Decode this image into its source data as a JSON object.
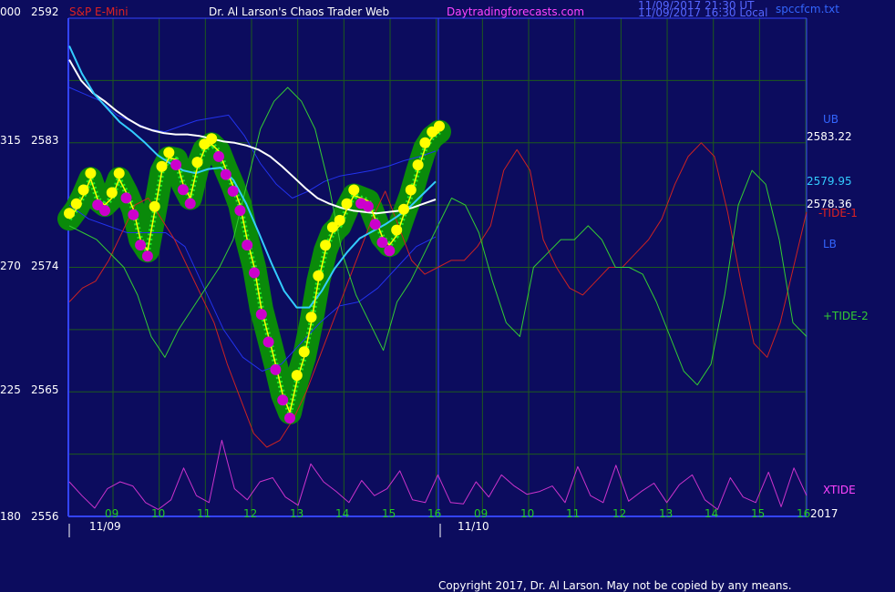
{
  "header": {
    "left_code": "000",
    "instrument": "S&P E-Mini",
    "app_title": "Dr. Al Larson's Chaos Trader Web",
    "site": "Daytradingforecasts.com",
    "time_utc": "11/09/2017 21:30 UT",
    "time_local": "11/09/2017 16:30 Local",
    "file": "spccfcm.txt"
  },
  "footer": {
    "copyright": "Copyright 2017, Dr. Al Larson. May not be copied by any means."
  },
  "colors": {
    "background": "#0c0c5e",
    "grid": "#1d5a1d",
    "frame": "#3344ff",
    "price_band": "#0a8a0a",
    "up_dot": "#ffff00",
    "down_dot": "#cc00cc",
    "white_ma": "#ffffff",
    "cyan_ma": "#33ccff",
    "band": "#2233ee",
    "tide1": "#cc2222",
    "tide2": "#33cc33",
    "xtide": "#cc33cc"
  },
  "chart_data": {
    "type": "line",
    "title": "S&P E-Mini",
    "ylim": [
      2556,
      2592
    ],
    "y_ticks": [
      {
        "code": "000",
        "value": "2592"
      },
      {
        "code": "315",
        "value": "2583"
      },
      {
        "code": "270",
        "value": "2574"
      },
      {
        "code": "225",
        "value": "2565"
      },
      {
        "code": "180",
        "value": "2556"
      }
    ],
    "x_hour_labels": [
      "09",
      "10",
      "11",
      "12",
      "13",
      "14",
      "15",
      "16",
      "09",
      "10",
      "11",
      "12",
      "13",
      "14",
      "15",
      "16"
    ],
    "x_date_labels": [
      "11/09",
      "11/10"
    ],
    "year_label": "2017",
    "right_labels": {
      "ub": "UB",
      "value1": "2583.22",
      "value2": "2579.95",
      "value3": "2578.36",
      "tide1": "-TIDE-1",
      "lb": "LB",
      "tide2": "+TIDE-2",
      "xtide": "XTIDE"
    },
    "series": [
      {
        "key": "price",
        "values": [
          2577.5,
          2578.2,
          2579.2,
          2580.4,
          2578.9,
          2578.5,
          2579.0,
          2580.4,
          2579.4,
          2578.2,
          2576.0,
          2575.2,
          2578.0,
          2580.9,
          2581.9,
          2581.8,
          2580.0,
          2579.0,
          2581.2,
          2582.5,
          2582.9,
          2582.4,
          2581.1,
          2579.9,
          2578.5,
          2576.0,
          2574.0,
          2571.0,
          2569.0,
          2567.0,
          2564.8,
          2563.5,
          2565.8,
          2567.5,
          2570.0,
          2573.0,
          2575.2,
          2576.5,
          2577.0,
          2578.2,
          2579.2,
          2579.0,
          2578.8,
          2577.5,
          2576.2,
          2575.6,
          2576.3,
          2577.8,
          2579.2,
          2581.0,
          2582.6,
          2583.4,
          2583.8
        ]
      },
      {
        "key": "white_ma",
        "values": [
          2589.0,
          2587.5,
          2586.6,
          2586.0,
          2585.3,
          2584.7,
          2584.2,
          2583.9,
          2583.7,
          2583.6,
          2583.6,
          2583.5,
          2583.3,
          2583.1,
          2583.0,
          2582.8,
          2582.5,
          2582.0,
          2581.3,
          2580.5,
          2579.7,
          2579.0,
          2578.6,
          2578.3,
          2578.1,
          2578.0,
          2577.9,
          2578.0,
          2578.1,
          2578.3,
          2578.6,
          2578.9
        ]
      },
      {
        "key": "cyan_ma",
        "values": [
          2590.0,
          2588.0,
          2586.5,
          2585.5,
          2584.5,
          2583.8,
          2583.0,
          2582.1,
          2581.5,
          2581.0,
          2580.8,
          2581.1,
          2581.2,
          2580.3,
          2578.6,
          2576.5,
          2574.3,
          2572.3,
          2571.1,
          2571.1,
          2572.3,
          2573.9,
          2575.1,
          2576.1,
          2576.6,
          2577.1,
          2577.7,
          2578.4,
          2579.3,
          2580.2
        ]
      },
      {
        "key": "upper_band",
        "values": [
          2587.0,
          2586.5,
          2586.0,
          2585.0,
          2584.5,
          2584.0,
          2583.8,
          2584.2,
          2584.6,
          2584.8,
          2585.0,
          2583.5,
          2581.5,
          2580.0,
          2579.0,
          2579.5,
          2580.2,
          2580.6,
          2580.8,
          2581.0,
          2581.3,
          2581.7,
          2582.0,
          2582.4
        ]
      },
      {
        "key": "lower_band",
        "values": [
          2578.5,
          2577.5,
          2577.0,
          2576.5,
          2576.5,
          2576.5,
          2575.5,
          2572.5,
          2569.5,
          2567.5,
          2566.5,
          2567.0,
          2568.5,
          2570.0,
          2571.2,
          2571.5,
          2572.5,
          2574.0,
          2575.5,
          2576.2
        ]
      },
      {
        "key": "tide1",
        "values": [
          2571.5,
          2572.5,
          2573.0,
          2574.5,
          2576.5,
          2578.5,
          2579.0,
          2577.5,
          2576.0,
          2574.0,
          2572.0,
          2570.0,
          2567.0,
          2564.5,
          2562.0,
          2561.0,
          2561.5,
          2563.0,
          2565.0,
          2567.5,
          2570.0,
          2572.5,
          2575.0,
          2577.5,
          2579.5,
          2577.0,
          2574.5,
          2573.5,
          2574.0,
          2574.5,
          2574.5,
          2575.5,
          2577.0,
          2581.0,
          2582.5,
          2581.0,
          2576.0,
          2574.0,
          2572.5,
          2572.0,
          2573.0,
          2574.0,
          2574.0,
          2575.0,
          2576.0,
          2577.5,
          2580.0,
          2582.0,
          2583.0,
          2582.0,
          2578.0,
          2573.0,
          2568.5,
          2567.5,
          2570.0,
          2574.0,
          2578.0
        ]
      },
      {
        "key": "tide2",
        "values": [
          2577.0,
          2576.5,
          2576.0,
          2575.0,
          2574.0,
          2572.0,
          2569.0,
          2567.5,
          2569.5,
          2571.0,
          2572.5,
          2574.0,
          2576.0,
          2580.0,
          2584.0,
          2586.0,
          2587.0,
          2586.0,
          2584.0,
          2580.0,
          2575.0,
          2572.0,
          2570.0,
          2568.0,
          2571.5,
          2573.0,
          2575.0,
          2577.0,
          2579.0,
          2578.5,
          2576.5,
          2573.0,
          2570.0,
          2569.0,
          2574.0,
          2575.0,
          2576.0,
          2576.0,
          2577.0,
          2576.0,
          2574.0,
          2574.0,
          2573.5,
          2571.5,
          2569.0,
          2566.5,
          2565.5,
          2567.0,
          2572.0,
          2578.5,
          2581.0,
          2580.0,
          2576.0,
          2570.0,
          2569.0
        ]
      },
      {
        "key": "xtide",
        "values": [
          2558.5,
          2557.5,
          2556.6,
          2558.0,
          2558.5,
          2558.2,
          2557.0,
          2556.5,
          2557.2,
          2559.5,
          2557.5,
          2557.0,
          2561.5,
          2558.0,
          2557.2,
          2558.5,
          2558.8,
          2557.4,
          2556.8,
          2559.8,
          2558.5,
          2557.8,
          2557.0,
          2558.6,
          2557.5,
          2558.0,
          2559.3,
          2557.2,
          2557.0,
          2559.0,
          2557.0,
          2556.9,
          2558.5,
          2557.4,
          2559.0,
          2558.2,
          2557.6,
          2557.8,
          2558.2,
          2557.0,
          2559.6,
          2557.5,
          2557.0,
          2559.7,
          2557.1,
          2557.8,
          2558.4,
          2557.0,
          2558.3,
          2559.0,
          2557.2,
          2556.5,
          2558.8,
          2557.4,
          2557.0,
          2559.2,
          2556.7,
          2559.5,
          2557.5
        ]
      }
    ]
  }
}
